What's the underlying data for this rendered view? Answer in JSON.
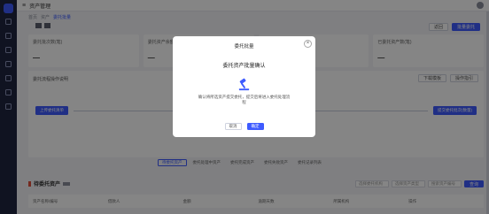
{
  "topbar": {
    "title": "资产管理"
  },
  "breadcrumb": [
    "首页",
    "资产",
    "委托批量"
  ],
  "top_actions": {
    "secondary": "返回",
    "primary": "批量委托"
  },
  "stats": [
    {
      "label": "委托批次数(笔)",
      "value": "—"
    },
    {
      "label": "委托资产余额(万元)",
      "value": "—"
    },
    {
      "label": "委托资产数(笔)",
      "value": "—"
    },
    {
      "label": "已委托资产数(笔)",
      "value": "—"
    }
  ],
  "panel": {
    "title": "委托流程操作说明",
    "actions": [
      "下载模板",
      "操作指引"
    ],
    "flow": [
      "上传委托清单",
      "确认委托资产",
      "提交委托批次(数量)"
    ]
  },
  "tabs": [
    "待委托资产",
    "委托处理中资产",
    "委托完成资产",
    "委托失败资产",
    "委托记录列表"
  ],
  "list": {
    "title": "待委托资产",
    "filters": [
      "选择委托机构",
      "选择资产类型",
      "搜索资产编号"
    ],
    "search_btn": "查询"
  },
  "table_headers": [
    "资产名称/编号",
    "借款人",
    "金额",
    "逾期天数",
    "所属机构",
    "操作"
  ],
  "modal": {
    "title": "委托批量",
    "subtitle": "委托资产批量确认",
    "description": "确认将所选资产提交委托，提交后将进入委托处理流程",
    "cancel": "取消",
    "confirm": "确定",
    "icon": "gavel-icon",
    "accent": "#3e5bff"
  }
}
